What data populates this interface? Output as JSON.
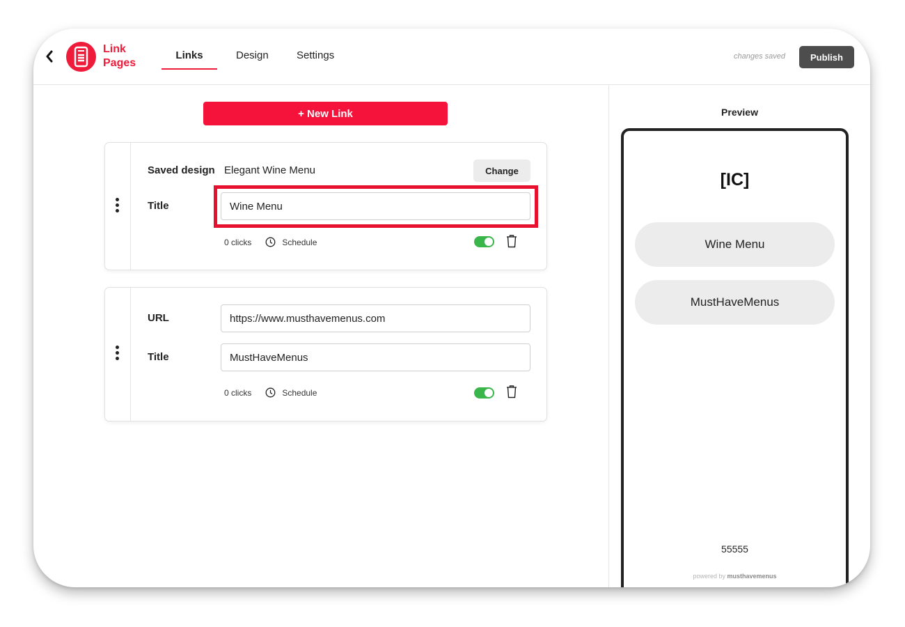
{
  "header": {
    "logo_line1": "Link",
    "logo_line2": "Pages",
    "tabs": [
      "Links",
      "Design",
      "Settings"
    ],
    "status": "changes saved",
    "publish_label": "Publish"
  },
  "main": {
    "new_link_label": "+ New Link",
    "cards": [
      {
        "saved_design_label": "Saved design",
        "saved_design_value": "Elegant Wine Menu",
        "change_label": "Change",
        "title_label": "Title",
        "title_value": "Wine Menu",
        "clicks": "0 clicks",
        "schedule_label": "Schedule",
        "enabled": true
      },
      {
        "url_label": "URL",
        "url_value": "https://www.musthavemenus.com",
        "title_label": "Title",
        "title_value": "MustHaveMenus",
        "clicks": "0 clicks",
        "schedule_label": "Schedule",
        "enabled": true
      }
    ]
  },
  "preview": {
    "title": "Preview",
    "logo": "[IC]",
    "buttons": [
      "Wine Menu",
      "MustHaveMenus"
    ],
    "footer_number": "55555",
    "powered_prefix": "powered by",
    "powered_brand": "musthavemenus"
  },
  "colors": {
    "brand_red": "#ee1b3a",
    "toggle_green": "#39b54a",
    "publish_gray": "#4d4d4d"
  }
}
